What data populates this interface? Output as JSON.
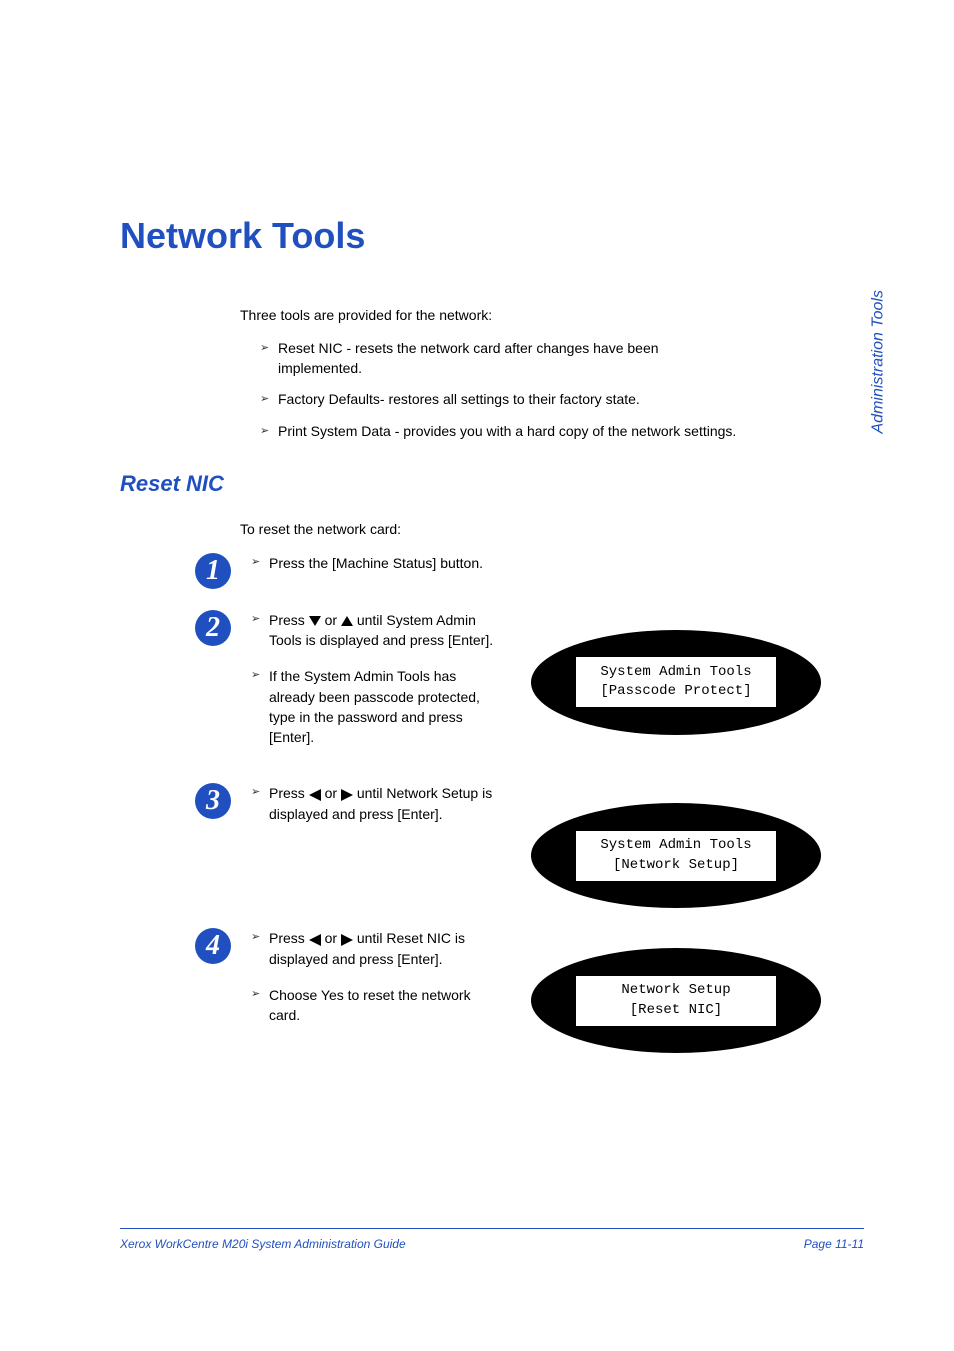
{
  "sideTab": "Administration Tools",
  "title": "Network Tools",
  "intro": "Three tools are provided for the network:",
  "bullets": [
    "Reset NIC - resets the network card after changes have been implemented.",
    "Factory Defaults- restores all settings to their factory state.",
    "Print System Data - provides you with a hard copy of the network settings."
  ],
  "subtitle": "Reset NIC",
  "subIntro": "To reset the network card:",
  "steps": {
    "s1": {
      "num": "1",
      "items": [
        "Press the [Machine Status] button."
      ]
    },
    "s2": {
      "num": "2",
      "item1_a": "Press ",
      "item1_b": " or ",
      "item1_c": " until System Admin Tools is displayed and press [Enter].",
      "item2": "If the System Admin Tools has already been passcode protected, type in the password and press [Enter].",
      "display": {
        "line1": "System Admin Tools",
        "line2": "[Passcode Protect]"
      }
    },
    "s3": {
      "num": "3",
      "item1_a": "Press ",
      "item1_b": " or ",
      "item1_c": " until Network Setup is displayed and press [Enter].",
      "display": {
        "line1": "System Admin Tools",
        "line2": "[Network Setup]"
      }
    },
    "s4": {
      "num": "4",
      "item1_a": "Press ",
      "item1_b": " or ",
      "item1_c": " until Reset NIC is displayed and press [Enter].",
      "item2": "Choose Yes to reset the network card.",
      "display": {
        "line1": "Network Setup",
        "line2": "[Reset NIC]"
      }
    }
  },
  "footer": {
    "left": "Xerox WorkCentre M20i System Administration Guide",
    "right": "Page 11-11"
  }
}
